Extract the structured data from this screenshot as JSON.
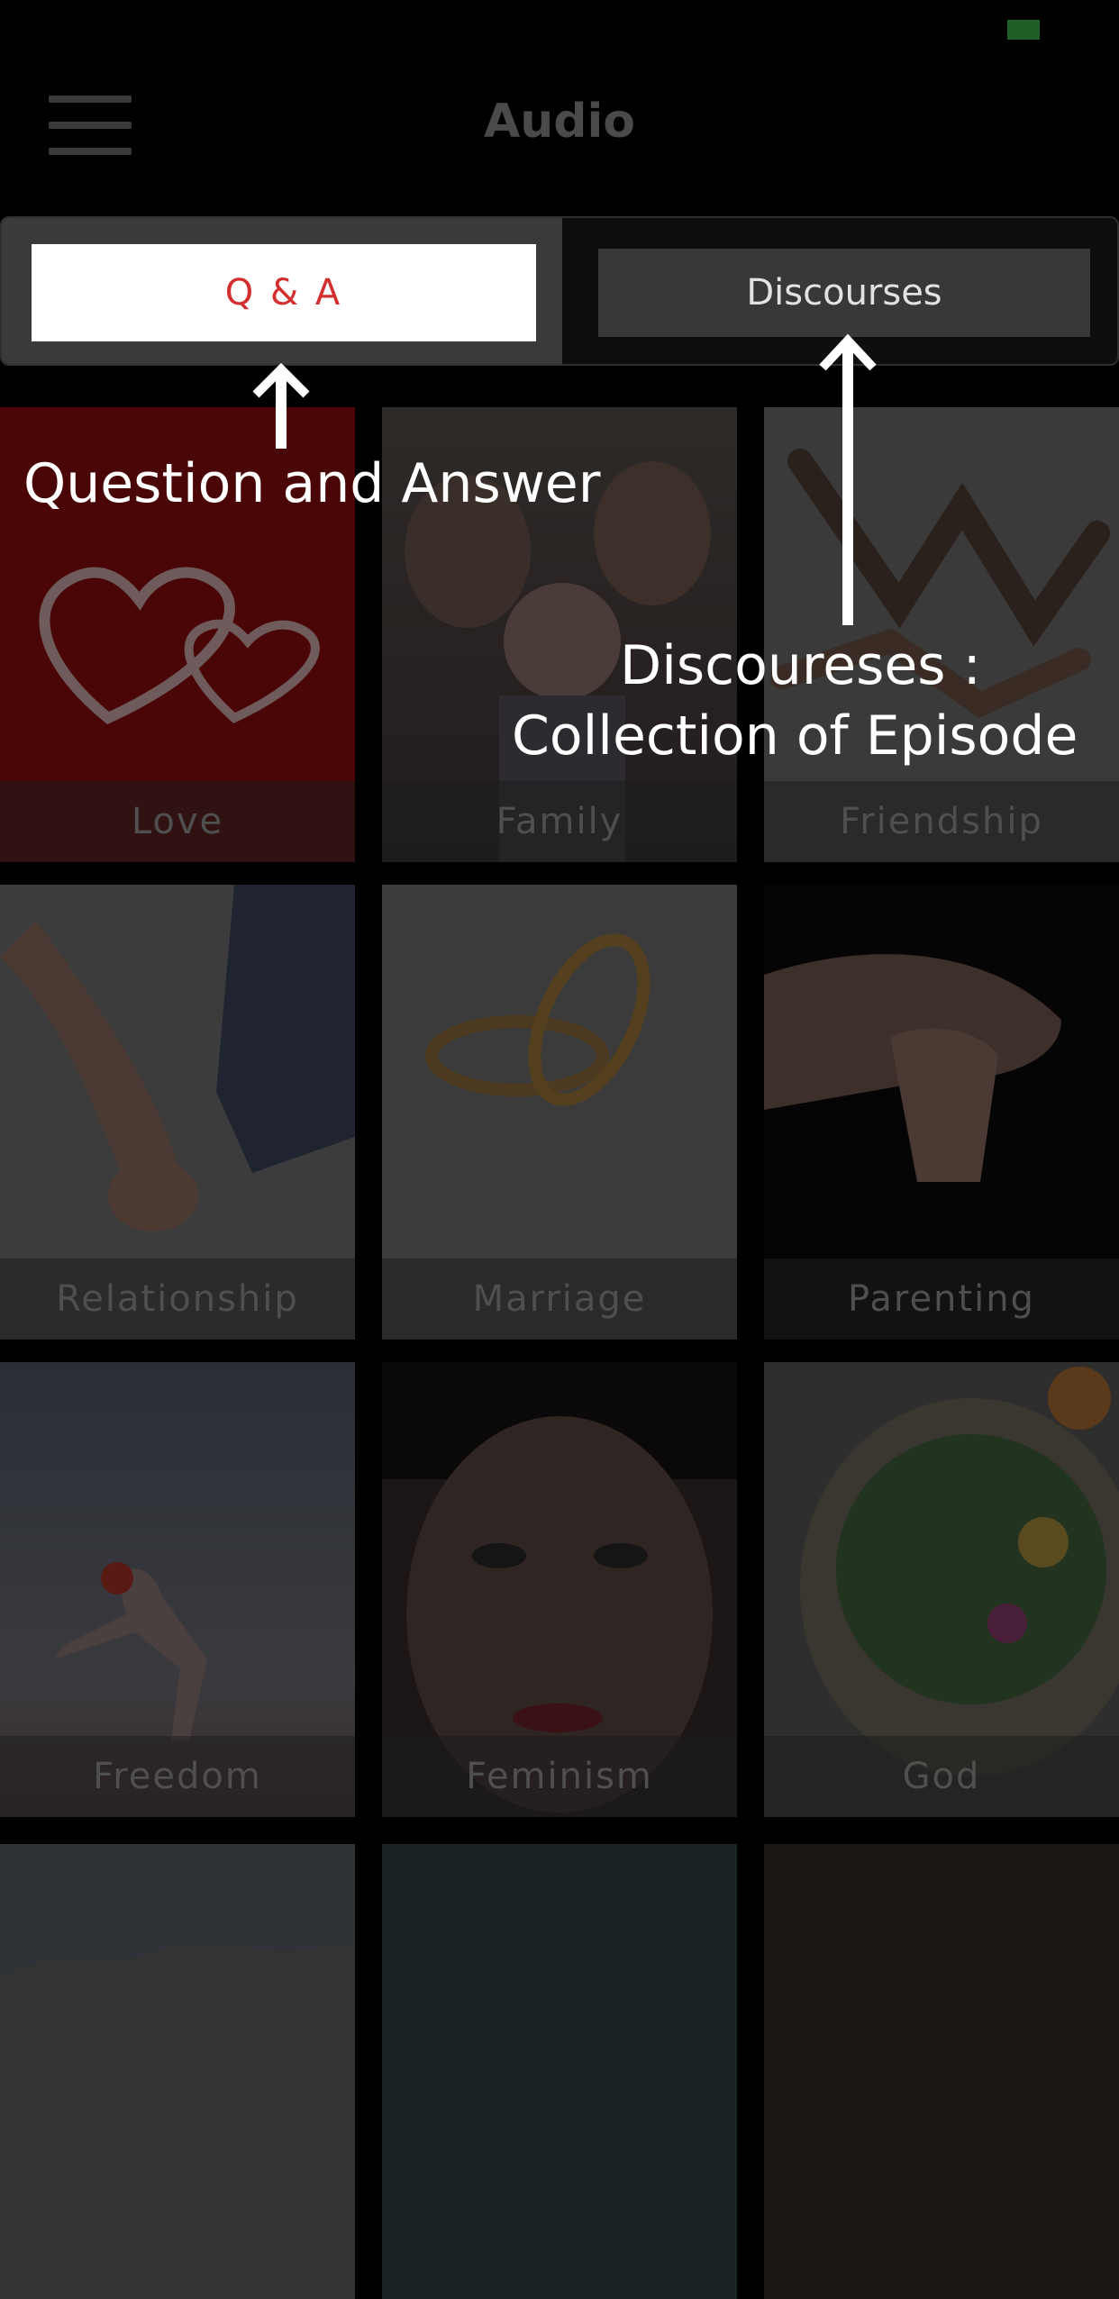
{
  "header": {
    "title": "Audio"
  },
  "tabs": [
    {
      "label": "Q & A",
      "active": true
    },
    {
      "label": "Discourses",
      "active": false
    }
  ],
  "categories": [
    {
      "label": "Love"
    },
    {
      "label": "Family"
    },
    {
      "label": "Friendship"
    },
    {
      "label": "Relationship"
    },
    {
      "label": "Marriage"
    },
    {
      "label": "Parenting"
    },
    {
      "label": "Freedom"
    },
    {
      "label": "Feminism"
    },
    {
      "label": "God"
    }
  ],
  "annotations": {
    "qa_note": "Question and Answer",
    "discourses_note_line1": "Discoureses :",
    "discourses_note_line2": "Collection of Episode"
  },
  "colors": {
    "active_tab_text": "#d32f2f",
    "status_indicator": "#1f5e25",
    "annotation_text": "#ffffff"
  }
}
